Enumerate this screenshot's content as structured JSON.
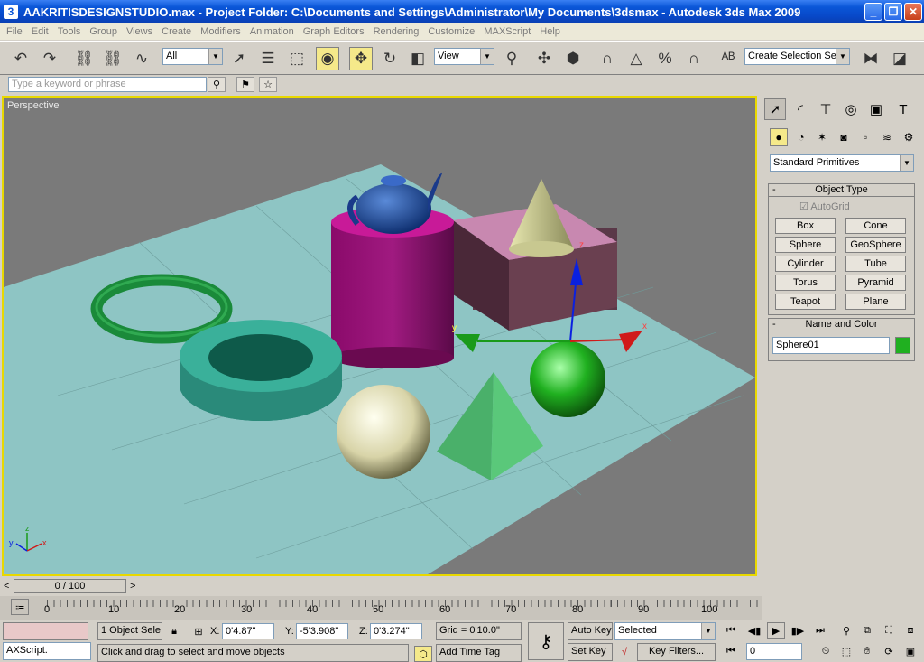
{
  "titlebar": {
    "title": "AAKRITISDESIGNSTUDIO.max   - Project Folder: C:\\Documents and Settings\\Administrator\\My Documents\\3dsmax   - Autodesk 3ds Max  2009",
    "app_icon": "3ds-max-icon",
    "minimize": "_",
    "maximize": "❐",
    "close": "✕"
  },
  "menu": [
    "File",
    "Edit",
    "Tools",
    "Group",
    "Views",
    "Create",
    "Modifiers",
    "Animation",
    "Graph Editors",
    "Rendering",
    "Customize",
    "MAXScript",
    "Help"
  ],
  "toolbar": {
    "selection_filter": "All",
    "ref_coord": "View",
    "selection_set_placeholder": "Create Selection Set"
  },
  "search": {
    "placeholder": "Type a keyword or phrase"
  },
  "viewport": {
    "label": "Perspective",
    "axis_x": "x",
    "axis_y": "y",
    "axis_z": "z"
  },
  "command_panel": {
    "primitive_type": "Standard Primitives",
    "object_type_title": "Object Type",
    "autogrid_label": "AutoGrid",
    "buttons": [
      "Box",
      "Cone",
      "Sphere",
      "GeoSphere",
      "Cylinder",
      "Tube",
      "Torus",
      "Pyramid",
      "Teapot",
      "Plane"
    ],
    "name_color_title": "Name and Color",
    "object_name": "Sphere01",
    "object_color": "#20b020"
  },
  "timeline": {
    "slider_label": "0 / 100",
    "prev": "<",
    "next": ">",
    "ticks": [
      "0",
      "10",
      "20",
      "30",
      "40",
      "50",
      "60",
      "70",
      "80",
      "90",
      "100"
    ]
  },
  "status": {
    "maxscript_label": "AXScript.",
    "selection_count": "1 Object Sele",
    "x_label": "X:",
    "x_value": "0'4.87\"",
    "y_label": "Y:",
    "y_value": "-5'3.908\"",
    "z_label": "Z:",
    "z_value": "0'3.274\"",
    "grid": "Grid = 0'10.0\"",
    "prompt": "Click and drag to select and move objects",
    "add_time_tag": "Add Time Tag",
    "auto_key": "Auto Key",
    "set_key": "Set Key",
    "key_mode": "Selected",
    "key_filters": "Key Filters...",
    "frame": "0"
  }
}
